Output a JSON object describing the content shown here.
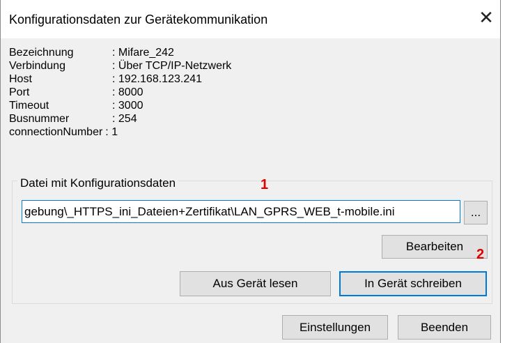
{
  "window": {
    "title": "Konfigurationsdaten zur Gerätekommunikation",
    "close_glyph": "✕"
  },
  "info": [
    {
      "label": "Bezeichnung",
      "value": ": Mifare_242"
    },
    {
      "label": "Verbindung",
      "value": ": Über TCP/IP-Netzwerk"
    },
    {
      "label": "Host",
      "value": ": 192.168.123.241"
    },
    {
      "label": "Port",
      "value": ": 8000"
    },
    {
      "label": "Timeout",
      "value": ": 3000"
    },
    {
      "label": "Busnummer",
      "value": ": 254"
    },
    {
      "label": "connectionNumber",
      "value": ": 1"
    }
  ],
  "config_file": {
    "group_caption": "Datei mit Konfigurationsdaten",
    "path_value": "gebung\\_HTTPS_ini_Dateien+Zertifikat\\LAN_GPRS_WEB_t-mobile.ini",
    "browse_label": "...",
    "edit_label": "Bearbeiten",
    "read_label": "Aus Gerät lesen",
    "write_label": "In Gerät schreiben"
  },
  "footer": {
    "settings_label": "Einstellungen",
    "close_label": "Beenden"
  },
  "annotations": {
    "marker_1": "1",
    "marker_2": "2",
    "color": "#e00000"
  }
}
